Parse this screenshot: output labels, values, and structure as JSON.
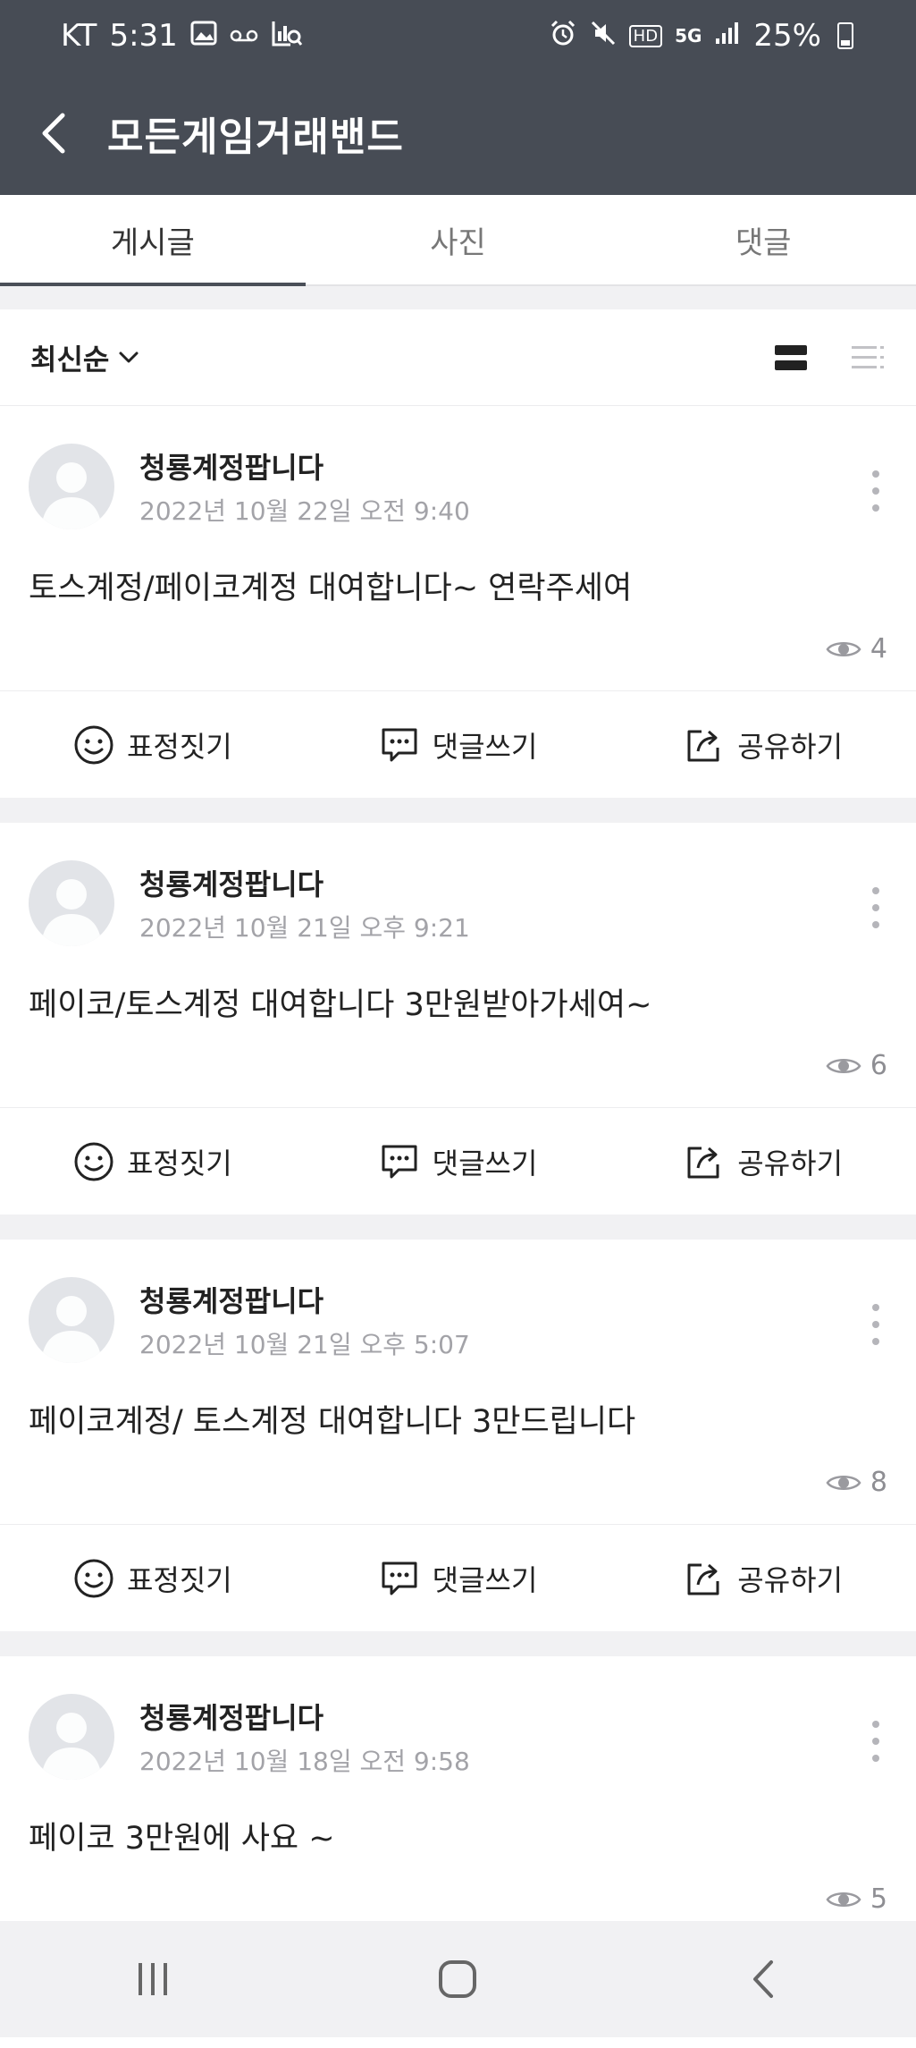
{
  "status": {
    "carrier": "KT",
    "time": "5:31",
    "network_label": "HD",
    "network_type": "5G",
    "battery": "25%",
    "icons": [
      "gallery-icon",
      "voicemail-icon",
      "screenshot-search-icon",
      "alarm-icon",
      "mute-icon",
      "signal-icon",
      "battery-icon"
    ]
  },
  "appbar": {
    "title": "모든게임거래밴드"
  },
  "tabs": [
    {
      "label": "게시글",
      "active": true
    },
    {
      "label": "사진",
      "active": false
    },
    {
      "label": "댓글",
      "active": false
    }
  ],
  "sort": {
    "label": "최신순"
  },
  "actions": {
    "emotion": "표정짓기",
    "comment": "댓글쓰기",
    "share": "공유하기"
  },
  "posts": [
    {
      "author": "청룡계정팝니다",
      "date": "2022년 10월 22일 오전 9:40",
      "body": "토스계정/페이코계정 대여합니다~ 연락주세여",
      "views": "4"
    },
    {
      "author": "청룡계정팝니다",
      "date": "2022년 10월 21일 오후 9:21",
      "body": "페이코/토스계정 대여합니다 3만원받아가세여~",
      "views": "6"
    },
    {
      "author": "청룡계정팝니다",
      "date": "2022년 10월 21일 오후 5:07",
      "body": "페이코계정/ 토스계정 대여합니다 3만드립니다",
      "views": "8"
    },
    {
      "author": "청룡계정팝니다",
      "date": "2022년 10월 18일 오전 9:58",
      "body": "페이코 3만원에 사요 ~",
      "views": "5"
    }
  ],
  "colors": {
    "header_bg": "#474c55",
    "background": "#f1f1f3",
    "text": "#222222",
    "muted": "#a3a3a8"
  }
}
